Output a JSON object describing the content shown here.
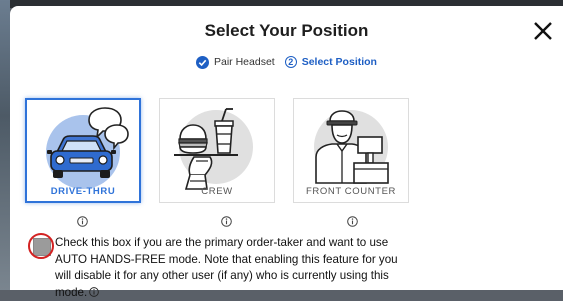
{
  "modal": {
    "title": "Select Your Position"
  },
  "steps": [
    {
      "label": "Pair Headset",
      "state": "complete",
      "icon": "check-circle-icon"
    },
    {
      "number": "2",
      "label": "Select Position",
      "state": "current"
    }
  ],
  "positions": [
    {
      "label": "DRIVE-THRU",
      "selected": true,
      "icon": "car-speech-bubbles-icon"
    },
    {
      "label": "CREW",
      "selected": false,
      "icon": "burger-drink-tray-icon"
    },
    {
      "label": "FRONT COUNTER",
      "selected": false,
      "icon": "cashier-register-icon"
    }
  ],
  "hands_free": {
    "checked": false,
    "text": "Check this box if you are the primary order-taker and want to use AUTO HANDS-FREE mode. Note that enabling this feature for you will disable it for any other user (if any) who is currently using this mode."
  },
  "colors": {
    "accent": "#2f73d9",
    "step_blue": "#1e5fc4",
    "highlight_ring": "#d32222",
    "illustration_gray": "#e0e0e0"
  }
}
